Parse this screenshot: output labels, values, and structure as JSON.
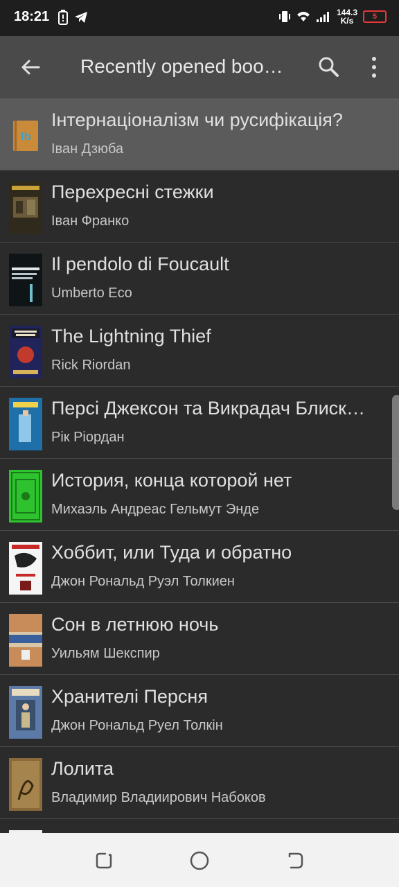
{
  "status": {
    "time": "18:21",
    "speed_value": "144.3",
    "speed_unit": "K/s",
    "battery": "5"
  },
  "app_bar": {
    "title": "Recently opened boo…"
  },
  "books": [
    {
      "title": "Інтернаціоналізм чи русифікація?",
      "author": "Іван Дзюба",
      "selected": true
    },
    {
      "title": "Перехресні стежки",
      "author": "Іван Франко"
    },
    {
      "title": "Il pendolo di Foucault",
      "author": "Umberto Eco"
    },
    {
      "title": "The Lightning Thief",
      "author": "Rick Riordan"
    },
    {
      "title": "Персі Джексон та Викрадач Блиск…",
      "author": "Рік Ріордан"
    },
    {
      "title": "История, конца которой нет",
      "author": "Михаэль Андреас Гельмут Энде"
    },
    {
      "title": "Хоббит, или Туда и обратно",
      "author": "Джон Рональд Руэл Толкиен"
    },
    {
      "title": "Сон в летнюю ночь",
      "author": "Уильям Шекспир"
    },
    {
      "title": "Хранителі Персня",
      "author": "Джон Рональд Руел Толкін"
    },
    {
      "title": "Лолита",
      "author": "Владимир Владиирович Набоков"
    }
  ],
  "icons": {
    "back": "arrow-left-icon",
    "search": "search-icon",
    "menu": "more-vert-icon",
    "nav_recents": "recents-icon",
    "nav_home": "home-icon",
    "nav_back": "back-icon"
  },
  "colors": {
    "app_bar": "#4a4a4a",
    "list_bg": "#2b2b2b",
    "selected_row": "#5b5b5b",
    "battery_low": "#e53935"
  }
}
